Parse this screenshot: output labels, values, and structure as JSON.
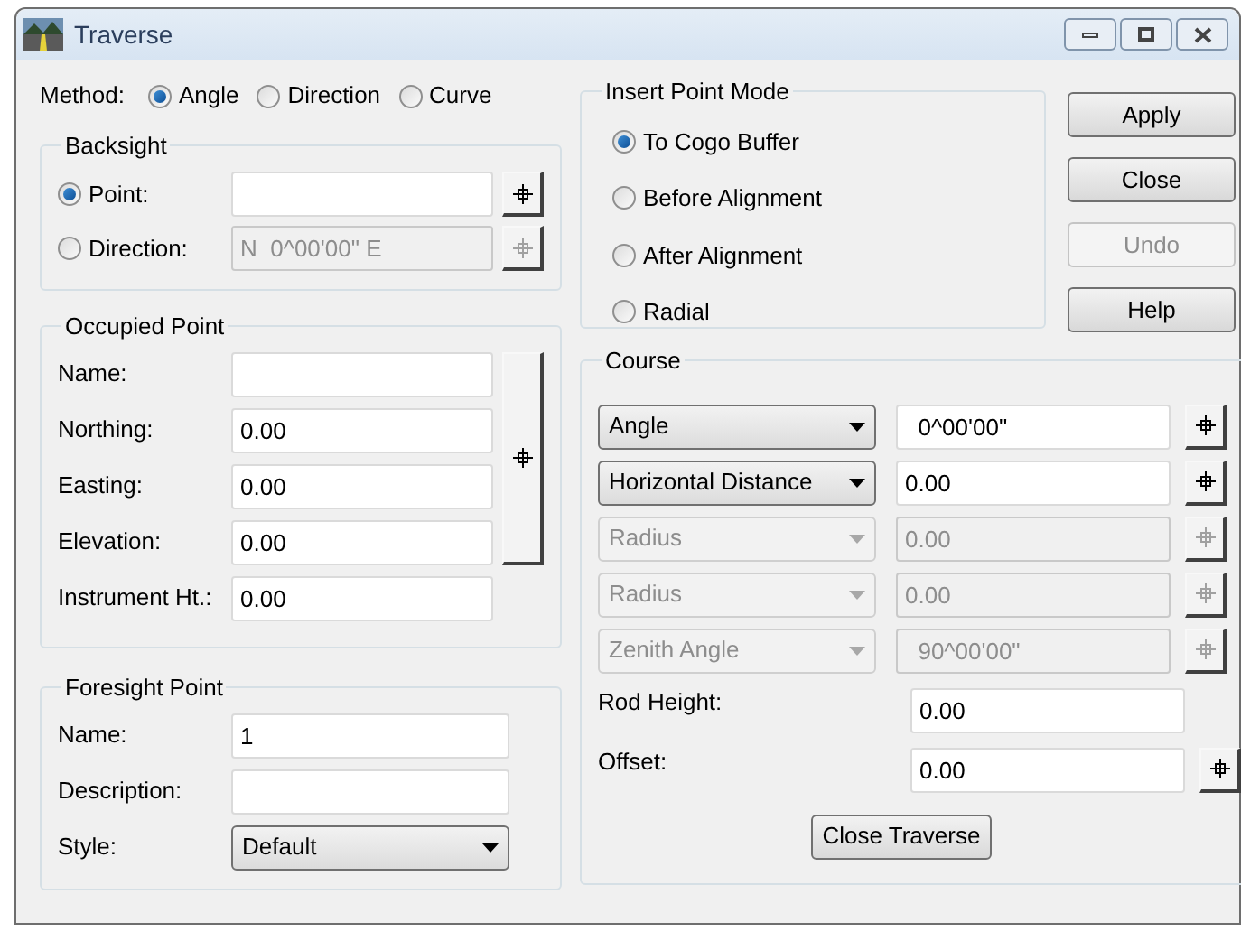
{
  "window": {
    "title": "Traverse"
  },
  "method": {
    "label": "Method:",
    "options": [
      {
        "label": "Angle",
        "selected": true
      },
      {
        "label": "Direction",
        "selected": false
      },
      {
        "label": "Curve",
        "selected": false
      }
    ]
  },
  "backsight": {
    "title": "Backsight",
    "rows": [
      {
        "label": "Point:",
        "selected": true,
        "disabled": false
      },
      {
        "label": "Direction:",
        "selected": false,
        "value": "N  0^00'00\" E",
        "disabled": true
      }
    ]
  },
  "occupied_point": {
    "title": "Occupied Point",
    "fields": [
      {
        "label": "Name:"
      },
      {
        "label": "Northing:",
        "value": "0.00"
      },
      {
        "label": "Easting:",
        "value": "0.00"
      },
      {
        "label": "Elevation:",
        "value": "0.00"
      },
      {
        "label": "Instrument Ht.:",
        "value": "0.00"
      }
    ]
  },
  "foresight_point": {
    "title": "Foresight Point",
    "fields": [
      {
        "kind": "text",
        "label": "Name:",
        "value": "1"
      },
      {
        "kind": "text",
        "label": "Description:"
      },
      {
        "kind": "select",
        "label": "Style:",
        "value": "Default"
      }
    ]
  },
  "insert_point_mode": {
    "title": "Insert Point Mode",
    "options": [
      {
        "label": "To Cogo Buffer",
        "selected": true
      },
      {
        "label": "Before Alignment",
        "selected": false
      },
      {
        "label": "After Alignment",
        "selected": false
      },
      {
        "label": "Radial",
        "selected": false
      }
    ]
  },
  "buttons": [
    {
      "label": "Apply",
      "disabled": false
    },
    {
      "label": "Close",
      "disabled": false
    },
    {
      "label": "Undo",
      "disabled": true
    },
    {
      "label": "Help",
      "disabled": false
    }
  ],
  "course": {
    "title": "Course",
    "rows": [
      {
        "kind": "select",
        "option": "Angle",
        "value": "  0^00'00\"",
        "disabled": false
      },
      {
        "kind": "select",
        "option": "Horizontal Distance",
        "value": "0.00",
        "disabled": false
      },
      {
        "kind": "select",
        "option": "Radius",
        "value": "0.00",
        "disabled": true
      },
      {
        "kind": "select",
        "option": "Radius",
        "value": "0.00",
        "disabled": true
      },
      {
        "kind": "select",
        "option": "Zenith Angle",
        "value": "  90^00'00\"",
        "disabled": true
      },
      {
        "kind": "field",
        "label": "Rod Height:",
        "value": "0.00",
        "pick_button": false
      },
      {
        "kind": "field",
        "label": "Offset:",
        "value": "0.00",
        "pick_button": true
      }
    ],
    "close_button": "Close Traverse"
  }
}
